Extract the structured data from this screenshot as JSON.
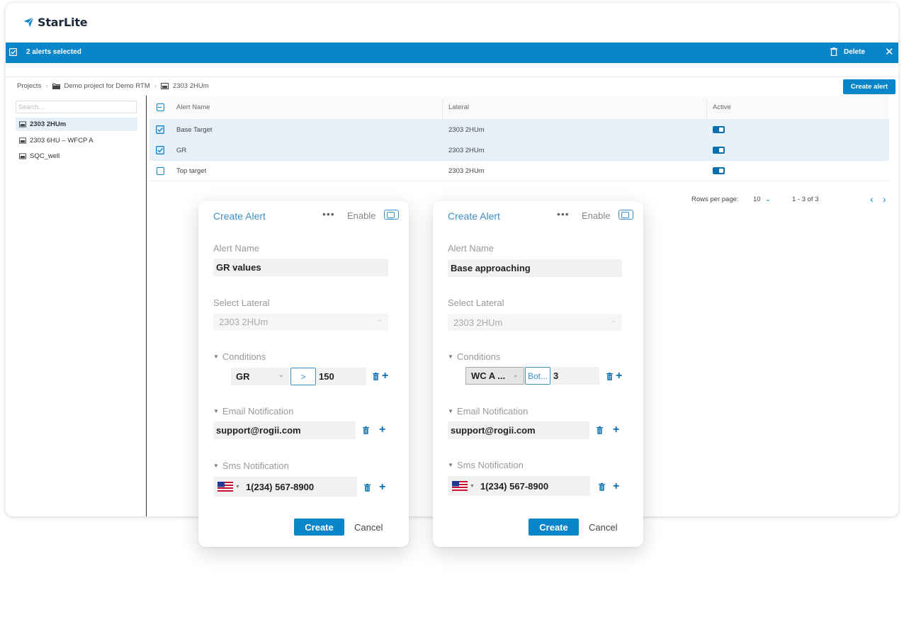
{
  "brand": {
    "name": "StarLite",
    "accent": "#0a85c9"
  },
  "selection_bar": {
    "count_text": "2 alerts selected",
    "delete_label": "Delete",
    "close_icon": "close-icon"
  },
  "breadcrumb": {
    "projects": "Projects",
    "project": "Demo project for Demo RTM",
    "well": "2303 2HUm"
  },
  "create_alert_button": "Create alert",
  "sidebar": {
    "search_placeholder": "Search...",
    "items": [
      {
        "label": "2303 2HUm",
        "active": true
      },
      {
        "label": "2303 6HU – WFCP A",
        "active": false
      },
      {
        "label": "SQC_well",
        "active": false
      }
    ]
  },
  "table": {
    "headers": {
      "name": "Alert Name",
      "lateral": "Lateral",
      "active": "Active"
    },
    "rows": [
      {
        "name": "Base Target",
        "lateral": "2303 2HUm",
        "selected": true,
        "active": true
      },
      {
        "name": "GR",
        "lateral": "2303 2HUm",
        "selected": true,
        "active": true
      },
      {
        "name": "Top target",
        "lateral": "2303 2HUm",
        "selected": false,
        "active": true
      }
    ]
  },
  "pagination": {
    "rows_per_page_label": "Rows per page:",
    "rows_per_page": "10",
    "range": "1 - 3 of 3"
  },
  "cards": [
    {
      "title": "Create Alert",
      "more": "•••",
      "enable_label": "Enable",
      "alert_name_label": "Alert Name",
      "alert_name": "GR values",
      "lateral_label": "Select Lateral",
      "lateral": "2303 2HUm",
      "conditions_label": "Conditions",
      "condition": {
        "field": "GR",
        "operator": ">",
        "value": "150"
      },
      "email_label": "Email Notification",
      "email": "support@rogii.com",
      "sms_label": "Sms Notification",
      "phone": "1(234) 567-8900",
      "create_label": "Create",
      "cancel_label": "Cancel"
    },
    {
      "title": "Create Alert",
      "more": "•••",
      "enable_label": "Enable",
      "alert_name_label": "Alert Name",
      "alert_name": "Base approaching",
      "lateral_label": "Select Lateral",
      "lateral": "2303 2HUm",
      "conditions_label": "Conditions",
      "condition": {
        "field": "WC A ...",
        "operator": "Bot...",
        "value": "3"
      },
      "email_label": "Email Notification",
      "email": "support@rogii.com",
      "sms_label": "Sms Notification",
      "phone": "1(234) 567-8900",
      "create_label": "Create",
      "cancel_label": "Cancel"
    }
  ]
}
